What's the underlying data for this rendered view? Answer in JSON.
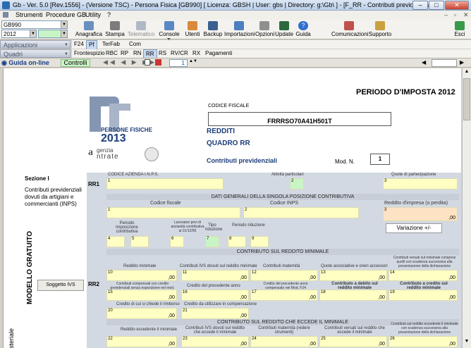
{
  "window": {
    "title": "Gb - Ver. 5.0 [Rev.1556] - (Versione TSC) - Persona Fisica [GB990]   [ Licenza: GBSH | User: gbs | Directory: g:\\Gb\\ ]  - [F_RR - Contributi previdenziali ]"
  },
  "menu": [
    "Strumenti",
    "Procedure GB",
    "Utility",
    "?"
  ],
  "selectors": {
    "module": "GB990",
    "year": "2012"
  },
  "toolbar": [
    "Anagrafica",
    "Stampa",
    "Telematico",
    "Console T.",
    "Utenti",
    "Backup",
    "Importazioni",
    "Opzioni",
    "Update",
    "Guida",
    "Comunicazioni",
    "Supporto",
    "Esci"
  ],
  "bars": {
    "applicazioni": "Applicazioni",
    "quadri": "Quadri"
  },
  "tabs_row1": [
    "F24",
    "Pf",
    "TerFab",
    "Com"
  ],
  "tabs_row2": [
    "Frontespizio",
    "RBC",
    "RP",
    "RN",
    "RR",
    "RS",
    "RV/CR",
    "RX",
    "Pagamenti"
  ],
  "nav": {
    "guida": "Guida on-line",
    "controlli": "Controlli",
    "page": "1"
  },
  "doc": {
    "periodo": "PERIODO D'IMPOSTA 2012",
    "cf_label": "CODICE FISCALE",
    "cf_value": "FRRRSO70A41H501T",
    "logo_line1": "PERSONE FISICHE",
    "logo_year": "2013",
    "agenzia1": "genzia",
    "agenzia2": "ntrate",
    "redditi": "REDDITI",
    "quadro": "QUADRO RR",
    "contributi": "Contributi previdenziali",
    "mod_label": "Mod. N.",
    "mod_value": "1",
    "sezione": "Sezione I",
    "sezione_desc": "Contributi previdenziali dovuti da artigiani e commercianti (INPS)",
    "modello_gratuito": "MODELLO GRATUITO",
    "ministeriale": "isteriale",
    "soggetto_ivs": "Soggetto IVS",
    "rr1": "RR1",
    "rr2": "RR2",
    "codice_azienda": "CODICE AZIENDA I.N.P.S.",
    "attivita": "Attività particolari",
    "quote": "Quote di partecipazione",
    "dati_generali": "DATI GENERALI DELLA SINGOLA POSIZIONE CONTRIBUTIVA",
    "codice_fiscale": "Codice fiscale",
    "codice_inps": "Codice INPS",
    "reddito_impresa": "Reddito d'impresa (o perdita)",
    "periodo_imposizione": "Periodo imposizione contributiva",
    "dal": "dal",
    "al": "al",
    "lavoratori": "Lavoratori privi di anzianità contributiva al 31/12/95",
    "tipo_riduzione": "Tipo riduzione",
    "periodo_riduzione": "Periodo riduzione",
    "variazione": "Variazione +/-",
    "zero": ",00",
    "contributo_minimo": "CONTRIBUTO SUL REDDITO MINIMALE",
    "reddito_minimale": "Reddito minimale",
    "ivs_minimale": "Contributi IVS dovuti sul reddito minimale",
    "maternita": "Contributi maternità",
    "quote_assoc": "Quote associative e oneri accessori",
    "versati_minimale": "Contributi versati sul minimale compresi quelli con scadenza successiva alla presentazione della dichiarazione",
    "compensati": "Contributi compensati con credito previdenziali senza esposizione nel mod. F24",
    "credito_prec": "Credito del precedente anno",
    "credito_prec_f24": "Credito del precedente anno compensato nel Mod. F24",
    "debito_minimale": "Contributo a debito sul reddito minimale",
    "credito_minimale": "Contributo a credito sul reddito minimale",
    "rimborso": "Credito di cui si chiede il rimborso",
    "compensazione": "Credito da utilizzare in compensazione",
    "contributo_eccede": "CONTRIBUTO SUL REDDITO CHE ECCEDE IL MINIMALE",
    "reddito_eccedente": "Reddito eccedente il minimale",
    "ivs_eccedente": "Contributi IVS dovuti sul reddito che eccede il minimale",
    "maternita_reg": "Contributi maternità (redere strumenti)",
    "versati_eccede": "Contributi versati sul reddito che eccede il minimale",
    "versati_eccedente_sc": "Contributi sul reddito eccedente il minimale con scadenza successiva alla presentazione della dichiarazione"
  }
}
